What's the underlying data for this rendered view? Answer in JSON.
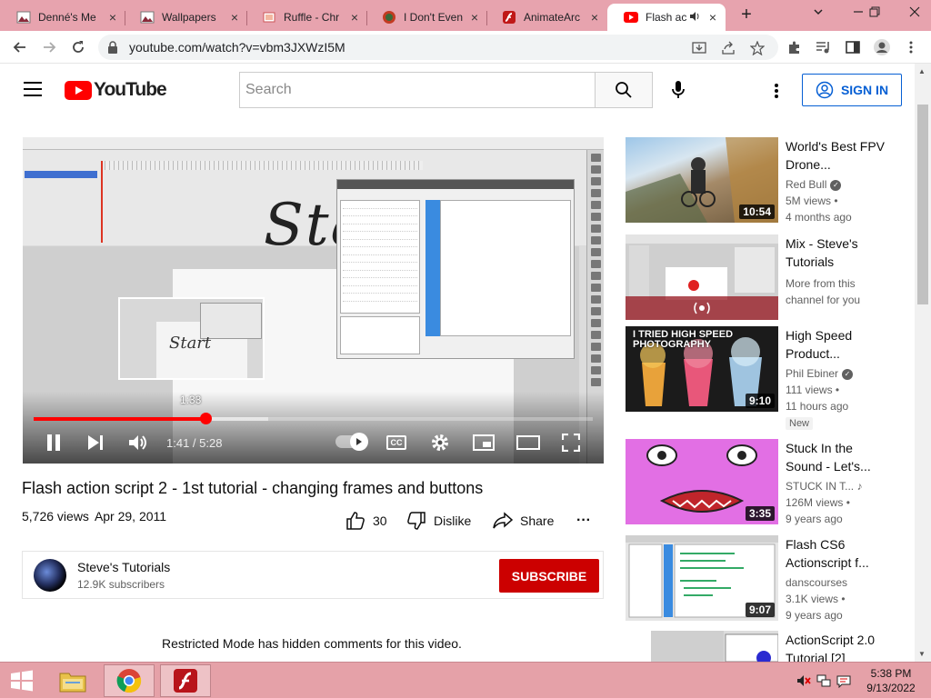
{
  "browser": {
    "tabs": [
      {
        "title": "Denné's Me",
        "icon": "wallpaper-favicon",
        "close": "×"
      },
      {
        "title": "Wallpapers",
        "icon": "wallpaper-favicon",
        "close": "×"
      },
      {
        "title": "Ruffle - Chr",
        "icon": "ruffle-favicon",
        "close": "×"
      },
      {
        "title": "I Don't Even",
        "icon": "site-favicon",
        "close": "×"
      },
      {
        "title": "AnimateArc",
        "icon": "flash-favicon",
        "close": "×"
      },
      {
        "title": "Flash ac",
        "icon": "youtube-favicon",
        "close": "×",
        "active": true
      }
    ],
    "new_tab": "+",
    "url": "youtube.com/watch?v=vbm3JXWzI5M"
  },
  "header": {
    "logo_text": "YouTube",
    "search_placeholder": "Search",
    "sign_in": "SIGN IN"
  },
  "video": {
    "title": "Flash action script 2 - 1st tutorial - changing frames and buttons",
    "views": "5,726 views",
    "date": "Apr 29, 2011",
    "likes": "30",
    "dislike_label": "Dislike",
    "share_label": "Share",
    "more": "···"
  },
  "player": {
    "current_time": "1:41",
    "separator": " / ",
    "duration": "5:28",
    "hover_time": "1:33",
    "played_fraction": 0.308,
    "buffered_fraction": 0.42,
    "hover_fraction": 0.284,
    "cc_label": "CC",
    "scribble_text": "Start"
  },
  "channel": {
    "name": "Steve's Tutorials",
    "subscribers": "12.9K subscribers",
    "subscribe": "SUBSCRIBE"
  },
  "comments": {
    "restricted": "Restricted Mode has hidden comments for this video."
  },
  "recommendations": [
    {
      "title": "World's Best FPV Drone...",
      "channel": "Red Bull",
      "verified": true,
      "views": "5M views",
      "age": "4 months ago",
      "duration": "10:54"
    },
    {
      "title": "Mix - Steve's Tutorials",
      "channel": "More from this channel for you",
      "views": "",
      "age": "",
      "duration": ""
    },
    {
      "title": "High Speed Product...",
      "channel": "Phil Ebiner",
      "verified": true,
      "views": "111 views",
      "age": "11 hours ago",
      "badge": "New",
      "duration": "9:10",
      "thumb_text": "I TRIED HIGH SPEED PHOTOGRAPHY"
    },
    {
      "title": "Stuck In the Sound - Let's...",
      "channel": "STUCK IN T...",
      "music": true,
      "views": "126M views",
      "age": "9 years ago",
      "duration": "3:35"
    },
    {
      "title": "Flash CS6 Actionscript f...",
      "channel": "danscourses",
      "views": "3.1K views",
      "age": "9 years ago",
      "duration": "9:07"
    },
    {
      "title": "ActionScript 2.0 Tutorial [2]",
      "channel": "",
      "views": "",
      "age": "",
      "duration": ""
    }
  ],
  "taskbar": {
    "time": "5:38 PM",
    "date": "9/13/2022"
  },
  "colors": {
    "tabstrip": "#e7a3ae",
    "youtube_red": "#ff0000",
    "subscribe_red": "#cc0000",
    "link_blue": "#065fd4",
    "taskbar": "#e5a1a8"
  }
}
